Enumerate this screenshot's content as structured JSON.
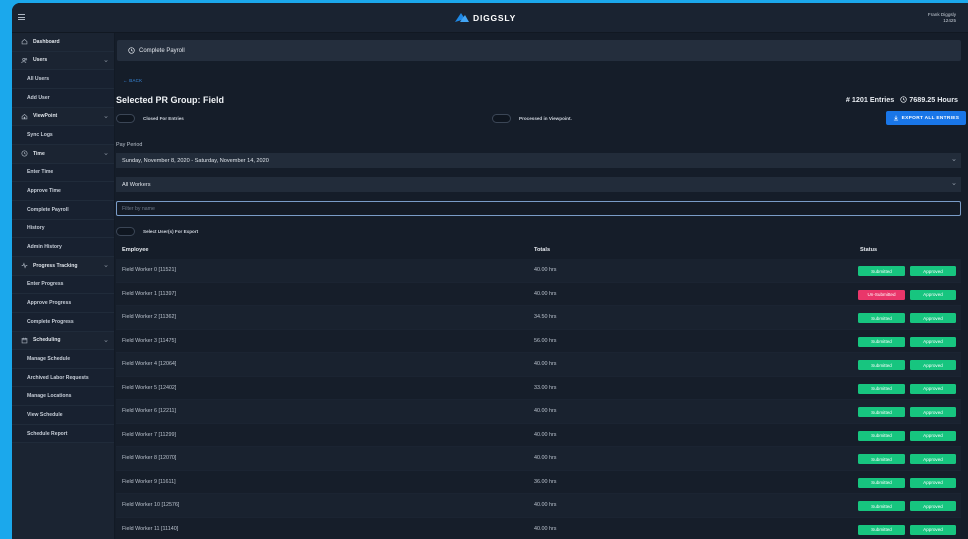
{
  "app": {
    "brand": "DIGGSLY",
    "user_name": "Frank Diggsly",
    "user_id": "12425"
  },
  "sidebar": {
    "items": [
      {
        "label": "Dashboard",
        "type": "top",
        "icon": "home-icon"
      },
      {
        "label": "Users",
        "type": "top",
        "icon": "users-icon",
        "expand": true
      },
      {
        "label": "All Users",
        "type": "sub"
      },
      {
        "label": "Add User",
        "type": "sub"
      },
      {
        "label": "ViewPoint",
        "type": "top",
        "icon": "viewpoint-icon",
        "expand": true
      },
      {
        "label": "Sync Logs",
        "type": "sub"
      },
      {
        "label": "Time",
        "type": "top",
        "icon": "clock-icon",
        "expand": true
      },
      {
        "label": "Enter Time",
        "type": "sub"
      },
      {
        "label": "Approve Time",
        "type": "sub"
      },
      {
        "label": "Complete Payroll",
        "type": "sub"
      },
      {
        "label": "History",
        "type": "sub"
      },
      {
        "label": "Admin History",
        "type": "sub"
      },
      {
        "label": "Progress Tracking",
        "type": "top",
        "icon": "activity-icon",
        "expand": true
      },
      {
        "label": "Enter Progress",
        "type": "sub"
      },
      {
        "label": "Approve Progress",
        "type": "sub"
      },
      {
        "label": "Complete Progress",
        "type": "sub"
      },
      {
        "label": "Scheduling",
        "type": "top",
        "icon": "calendar-icon",
        "expand": true
      },
      {
        "label": "Manage Schedule",
        "type": "sub"
      },
      {
        "label": "Archived Labor Requests",
        "type": "sub"
      },
      {
        "label": "Manage Locations",
        "type": "sub"
      },
      {
        "label": "View Schedule",
        "type": "sub"
      },
      {
        "label": "Schedule Report",
        "type": "sub"
      }
    ]
  },
  "main": {
    "breadcrumb": "Complete Payroll",
    "back_label": "BACK",
    "title": "Selected PR Group: Field",
    "entries_count": "# 1201 Entries",
    "hours_total": "7689.25 Hours",
    "toggle_closed_label": "Closed For Entries",
    "toggle_processed_label": "Processed in Viewpoint.",
    "export_label": "EXPORT ALL ENTRIES",
    "pay_period_label": "Pay Period",
    "pay_period_value": "Sunday, November 8, 2020 - Saturday, November 14, 2020",
    "workers_value": "All Workers",
    "filter_placeholder": "Filter by name",
    "select_export_label": "Select User(s) For Export",
    "table": {
      "headers": {
        "employee": "Employee",
        "totals": "Totals",
        "status": "Status"
      },
      "rows": [
        {
          "employee": "Field Worker 0 [11521]",
          "totals": "40.00 hrs",
          "submit": "Submitted",
          "approve": "Approved"
        },
        {
          "employee": "Field Worker 1 [11397]",
          "totals": "40.00 hrs",
          "submit": "Un-Submitted",
          "approve": "Approved"
        },
        {
          "employee": "Field Worker 2 [11362]",
          "totals": "34.50 hrs",
          "submit": "Submitted",
          "approve": "Approved"
        },
        {
          "employee": "Field Worker 3 [11475]",
          "totals": "56.00 hrs",
          "submit": "Submitted",
          "approve": "Approved"
        },
        {
          "employee": "Field Worker 4 [12064]",
          "totals": "40.00 hrs",
          "submit": "Submitted",
          "approve": "Approved"
        },
        {
          "employee": "Field Worker 5 [12402]",
          "totals": "33.00 hrs",
          "submit": "Submitted",
          "approve": "Approved"
        },
        {
          "employee": "Field Worker 6 [12211]",
          "totals": "40.00 hrs",
          "submit": "Submitted",
          "approve": "Approved"
        },
        {
          "employee": "Field Worker 7 [11299]",
          "totals": "40.00 hrs",
          "submit": "Submitted",
          "approve": "Approved"
        },
        {
          "employee": "Field Worker 8 [12070]",
          "totals": "40.00 hrs",
          "submit": "Submitted",
          "approve": "Approved"
        },
        {
          "employee": "Field Worker 9 [11611]",
          "totals": "36.00 hrs",
          "submit": "Submitted",
          "approve": "Approved"
        },
        {
          "employee": "Field Worker 10 [12576]",
          "totals": "40.00 hrs",
          "submit": "Submitted",
          "approve": "Approved"
        },
        {
          "employee": "Field Worker 11 [11140]",
          "totals": "40.00 hrs",
          "submit": "Submitted",
          "approve": "Approved"
        }
      ]
    }
  },
  "colors": {
    "background": "#1ba8ec",
    "accent": "#1976e8",
    "success": "#17c57f",
    "danger": "#e9366a"
  }
}
